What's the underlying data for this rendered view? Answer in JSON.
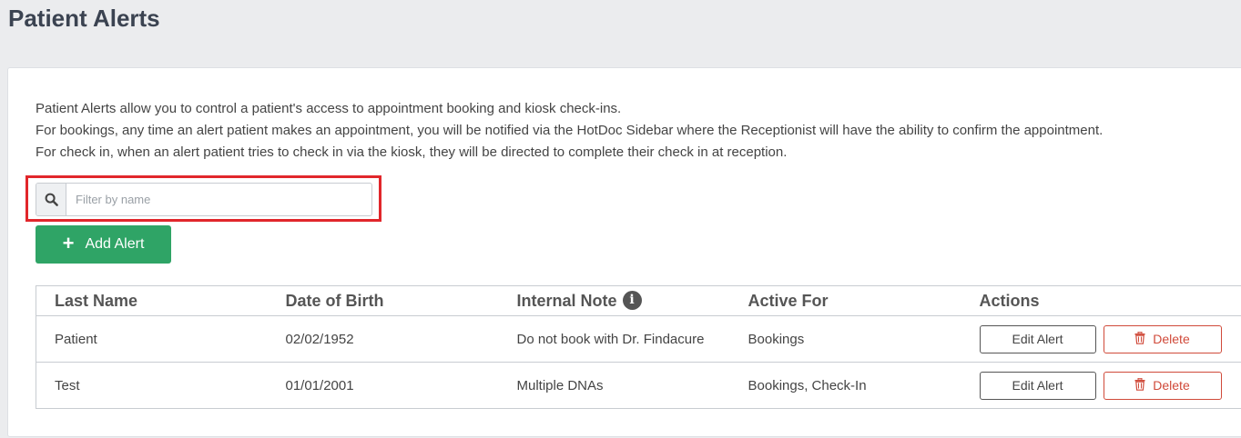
{
  "page": {
    "title": "Patient Alerts"
  },
  "intro": {
    "line1": "Patient Alerts allow you to control a patient's access to appointment booking and kiosk check-ins.",
    "line2": "For bookings, any time an alert patient makes an appointment, you will be notified via the HotDoc Sidebar where the Receptionist will have the ability to confirm the appointment.",
    "line3": "For check in, when an alert patient tries to check in via the kiosk, they will be directed to complete their check in at reception."
  },
  "search": {
    "placeholder": "Filter by name",
    "icon": "search-icon"
  },
  "add_button": {
    "label": "Add Alert",
    "icon": "plus-icon",
    "color": "#2fa466"
  },
  "table": {
    "headers": {
      "last_name": "Last Name",
      "dob": "Date of Birth",
      "note": "Internal Note",
      "active_for": "Active For",
      "actions": "Actions"
    },
    "info_icon": "i",
    "rows": [
      {
        "last_name": "Patient",
        "dob": "02/02/1952",
        "note": "Do not book with Dr. Findacure",
        "active_for": "Bookings",
        "edit": "Edit Alert",
        "delete": "Delete"
      },
      {
        "last_name": "Test",
        "dob": "01/01/2001",
        "note": "Multiple DNAs",
        "active_for": "Bookings, Check-In",
        "edit": "Edit Alert",
        "delete": "Delete"
      }
    ]
  },
  "colors": {
    "highlight": "#e1262b",
    "delete": "#d04a3a"
  }
}
